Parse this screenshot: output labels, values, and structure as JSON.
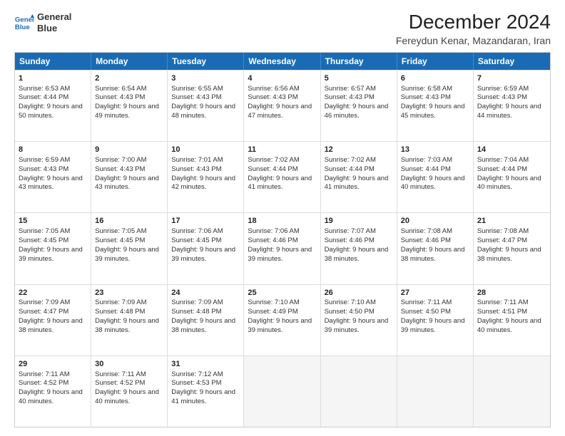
{
  "header": {
    "logo_line1": "General",
    "logo_line2": "Blue",
    "title": "December 2024",
    "subtitle": "Fereydun Kenar, Mazandaran, Iran"
  },
  "calendar": {
    "headers": [
      "Sunday",
      "Monday",
      "Tuesday",
      "Wednesday",
      "Thursday",
      "Friday",
      "Saturday"
    ],
    "rows": [
      [
        {
          "day": "1",
          "sunrise": "6:53 AM",
          "sunset": "4:44 PM",
          "daylight": "9 hours and 50 minutes."
        },
        {
          "day": "2",
          "sunrise": "6:54 AM",
          "sunset": "4:43 PM",
          "daylight": "9 hours and 49 minutes."
        },
        {
          "day": "3",
          "sunrise": "6:55 AM",
          "sunset": "4:43 PM",
          "daylight": "9 hours and 48 minutes."
        },
        {
          "day": "4",
          "sunrise": "6:56 AM",
          "sunset": "4:43 PM",
          "daylight": "9 hours and 47 minutes."
        },
        {
          "day": "5",
          "sunrise": "6:57 AM",
          "sunset": "4:43 PM",
          "daylight": "9 hours and 46 minutes."
        },
        {
          "day": "6",
          "sunrise": "6:58 AM",
          "sunset": "4:43 PM",
          "daylight": "9 hours and 45 minutes."
        },
        {
          "day": "7",
          "sunrise": "6:59 AM",
          "sunset": "4:43 PM",
          "daylight": "9 hours and 44 minutes."
        }
      ],
      [
        {
          "day": "8",
          "sunrise": "6:59 AM",
          "sunset": "4:43 PM",
          "daylight": "9 hours and 43 minutes."
        },
        {
          "day": "9",
          "sunrise": "7:00 AM",
          "sunset": "4:43 PM",
          "daylight": "9 hours and 43 minutes."
        },
        {
          "day": "10",
          "sunrise": "7:01 AM",
          "sunset": "4:43 PM",
          "daylight": "9 hours and 42 minutes."
        },
        {
          "day": "11",
          "sunrise": "7:02 AM",
          "sunset": "4:44 PM",
          "daylight": "9 hours and 41 minutes."
        },
        {
          "day": "12",
          "sunrise": "7:02 AM",
          "sunset": "4:44 PM",
          "daylight": "9 hours and 41 minutes."
        },
        {
          "day": "13",
          "sunrise": "7:03 AM",
          "sunset": "4:44 PM",
          "daylight": "9 hours and 40 minutes."
        },
        {
          "day": "14",
          "sunrise": "7:04 AM",
          "sunset": "4:44 PM",
          "daylight": "9 hours and 40 minutes."
        }
      ],
      [
        {
          "day": "15",
          "sunrise": "7:05 AM",
          "sunset": "4:45 PM",
          "daylight": "9 hours and 39 minutes."
        },
        {
          "day": "16",
          "sunrise": "7:05 AM",
          "sunset": "4:45 PM",
          "daylight": "9 hours and 39 minutes."
        },
        {
          "day": "17",
          "sunrise": "7:06 AM",
          "sunset": "4:45 PM",
          "daylight": "9 hours and 39 minutes."
        },
        {
          "day": "18",
          "sunrise": "7:06 AM",
          "sunset": "4:46 PM",
          "daylight": "9 hours and 39 minutes."
        },
        {
          "day": "19",
          "sunrise": "7:07 AM",
          "sunset": "4:46 PM",
          "daylight": "9 hours and 38 minutes."
        },
        {
          "day": "20",
          "sunrise": "7:08 AM",
          "sunset": "4:46 PM",
          "daylight": "9 hours and 38 minutes."
        },
        {
          "day": "21",
          "sunrise": "7:08 AM",
          "sunset": "4:47 PM",
          "daylight": "9 hours and 38 minutes."
        }
      ],
      [
        {
          "day": "22",
          "sunrise": "7:09 AM",
          "sunset": "4:47 PM",
          "daylight": "9 hours and 38 minutes."
        },
        {
          "day": "23",
          "sunrise": "7:09 AM",
          "sunset": "4:48 PM",
          "daylight": "9 hours and 38 minutes."
        },
        {
          "day": "24",
          "sunrise": "7:09 AM",
          "sunset": "4:48 PM",
          "daylight": "9 hours and 38 minutes."
        },
        {
          "day": "25",
          "sunrise": "7:10 AM",
          "sunset": "4:49 PM",
          "daylight": "9 hours and 39 minutes."
        },
        {
          "day": "26",
          "sunrise": "7:10 AM",
          "sunset": "4:50 PM",
          "daylight": "9 hours and 39 minutes."
        },
        {
          "day": "27",
          "sunrise": "7:11 AM",
          "sunset": "4:50 PM",
          "daylight": "9 hours and 39 minutes."
        },
        {
          "day": "28",
          "sunrise": "7:11 AM",
          "sunset": "4:51 PM",
          "daylight": "9 hours and 40 minutes."
        }
      ],
      [
        {
          "day": "29",
          "sunrise": "7:11 AM",
          "sunset": "4:52 PM",
          "daylight": "9 hours and 40 minutes."
        },
        {
          "day": "30",
          "sunrise": "7:11 AM",
          "sunset": "4:52 PM",
          "daylight": "9 hours and 40 minutes."
        },
        {
          "day": "31",
          "sunrise": "7:12 AM",
          "sunset": "4:53 PM",
          "daylight": "9 hours and 41 minutes."
        },
        null,
        null,
        null,
        null
      ]
    ]
  }
}
